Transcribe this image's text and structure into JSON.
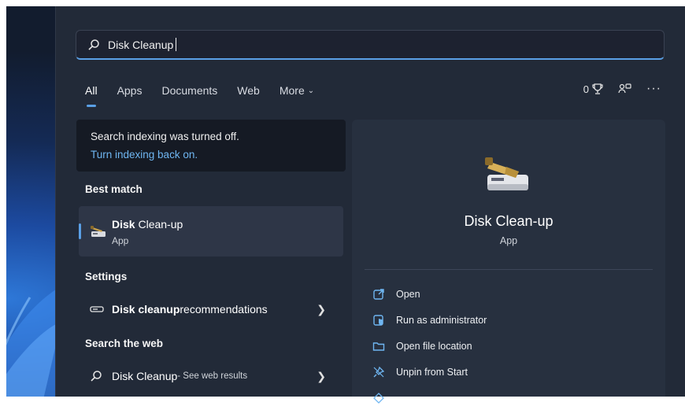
{
  "search": {
    "query": "Disk Cleanup"
  },
  "tabs": [
    {
      "label": "All"
    },
    {
      "label": "Apps"
    },
    {
      "label": "Documents"
    },
    {
      "label": "Web"
    },
    {
      "label": "More"
    }
  ],
  "top_right": {
    "points": "0"
  },
  "notice": {
    "text": "Search indexing was turned off.",
    "link": "Turn indexing back on."
  },
  "best_match": {
    "heading": "Best match",
    "name_bold": "Disk",
    "name_rest": " Clean-up",
    "type": "App"
  },
  "settings": {
    "heading": "Settings",
    "item_bold": "Disk cleanup",
    "item_rest": " recommendations"
  },
  "web": {
    "heading": "Search the web",
    "item_main": "Disk Cleanup",
    "item_sub": " - See web results"
  },
  "detail": {
    "name": "Disk Clean-up",
    "type": "App",
    "actions": [
      {
        "label": "Open",
        "icon": "open-external-icon"
      },
      {
        "label": "Run as administrator",
        "icon": "shield-admin-icon"
      },
      {
        "label": "Open file location",
        "icon": "folder-icon"
      },
      {
        "label": "Unpin from Start",
        "icon": "unpin-icon"
      }
    ]
  },
  "colors": {
    "accent": "#5aa0e6",
    "link": "#6fb6f2",
    "panel": "#222a38"
  }
}
